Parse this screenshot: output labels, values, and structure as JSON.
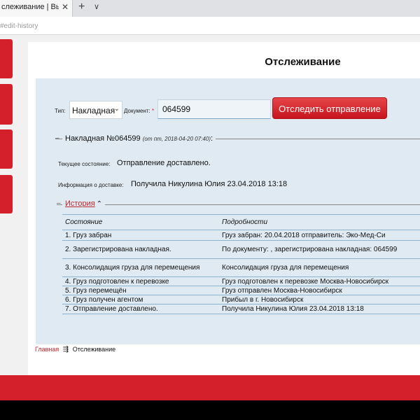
{
  "browser": {
    "tab_title": "слеживание | Выдан",
    "tab_close": "✕",
    "new_tab": "+",
    "tab_menu": "∨",
    "url": "#edit-history"
  },
  "page": {
    "title": "Отслеживание"
  },
  "form": {
    "type_label": "Тип:",
    "type_value": "Накладная",
    "doc_label": "Документ:",
    "doc_required": "*",
    "doc_value": "064599",
    "track_button": "Отследить отправление"
  },
  "waybill": {
    "title": "Накладная №064599",
    "meta": "(от пт, 2018-04-20 07:40)",
    "suffix": ":",
    "state_label": "Текущее состояние:",
    "state_value": "Отправление доставлено.",
    "delivery_label": "Информация о доставке:",
    "delivery_value": "Получила Никулина Юлия 23.04.2018 13:18"
  },
  "history": {
    "toggle_label": "История",
    "caret": "⌃",
    "columns": [
      "Состояние",
      "Подробности"
    ],
    "rows": [
      {
        "state": "1.  Груз забран",
        "details": "Груз забран: 20.04.2018 отправитель: Эко-Мед-Си"
      },
      {
        "state": "2.  Зарегистрирована накладная.",
        "details": "По документу: , зарегистрирована накладная: 064599"
      },
      {
        "state": "3.  Консолидация груза для перемещения",
        "details": "Консолидация груза для перемещения"
      },
      {
        "state": "4.  Груз подготовлен к перевозке",
        "details": "Груз подготовлен к перевозке Москва-Новосибирск"
      },
      {
        "state": "5.  Груз перемещён",
        "details": "Груз отправлен Москва-Новосибирск"
      },
      {
        "state": "6.  Груз получен агентом",
        "details": "Прибыл в г. Новосибирск"
      },
      {
        "state": "7.  Отправление доставлено.",
        "details": "Получила Никулина Юлия 23.04.2018 13:18"
      }
    ]
  },
  "breadcrumb": {
    "home": "Главная",
    "separator": "⇶",
    "current": "Отслеживание"
  },
  "colors": {
    "brand_red": "#d3202a",
    "panel_bg": "#dfeaf2"
  }
}
